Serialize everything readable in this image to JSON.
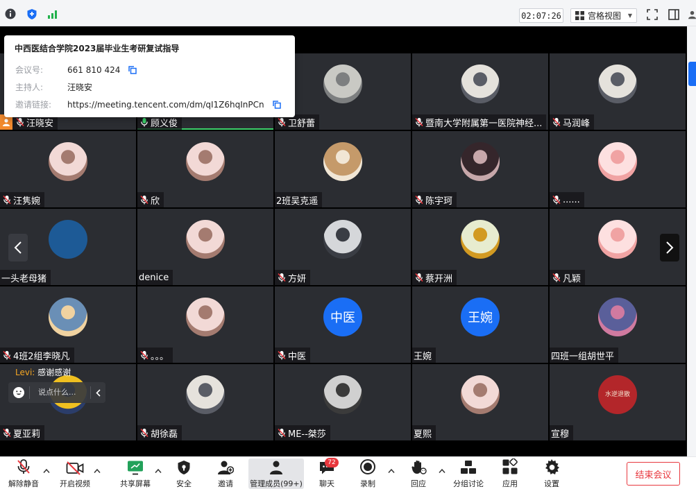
{
  "meeting_info": {
    "title": "中西医结合学院2023届毕业生考研复试指导",
    "rows": [
      {
        "key": "会议号:",
        "value": "661 810 424"
      },
      {
        "key": "主持人:",
        "value": "汪晓安"
      },
      {
        "key": "邀请链接:",
        "value": "https://meeting.tencent.com/dm/qI1Z6hqInPCn"
      }
    ]
  },
  "topbar": {
    "timer": "02:07:26",
    "view_label": "宫格视图"
  },
  "participants": [
    {
      "name": "汪晓安",
      "muted": true,
      "avatar": "none"
    },
    {
      "name": "顾义俊",
      "muted": false,
      "avatar": "none"
    },
    {
      "name": "卫舒蕾",
      "muted": true,
      "avatar": "cat-photo"
    },
    {
      "name": "暨南大学附属第一医院神经...",
      "muted": true,
      "avatar": "man-photo"
    },
    {
      "name": "马润峰",
      "muted": true,
      "avatar": "man-photo"
    },
    {
      "name": "汪隽婉",
      "muted": true,
      "avatar": "girl-photo"
    },
    {
      "name": "欣",
      "muted": true,
      "avatar": "girl-photo"
    },
    {
      "name": "2班吴克遥",
      "muted": false,
      "avatar": "dog-photo"
    },
    {
      "name": "陈宇珂",
      "muted": true,
      "avatar": "art-photo"
    },
    {
      "name": "......",
      "muted": true,
      "avatar": "cartoon-photo"
    },
    {
      "name": "一头老母猪",
      "muted": false,
      "avatar": "blue-circle"
    },
    {
      "name": "denice",
      "muted": false,
      "avatar": "girl-photo"
    },
    {
      "name": "方妍",
      "muted": true,
      "avatar": "face-photo"
    },
    {
      "name": "蔡开洲",
      "muted": true,
      "avatar": "flower-photo"
    },
    {
      "name": "凡颖",
      "muted": true,
      "avatar": "cartoon-photo"
    },
    {
      "name": "4班2组李晓凡",
      "muted": true,
      "avatar": "anime-photo"
    },
    {
      "name": "。。。",
      "muted": true,
      "avatar": "girl-photo"
    },
    {
      "name": "中医",
      "muted": true,
      "avatar": "text",
      "avatar_text": "中医"
    },
    {
      "name": "王婉",
      "muted": false,
      "avatar": "text",
      "avatar_text": "王婉"
    },
    {
      "name": "四班一组胡世平",
      "muted": false,
      "avatar": "sunset-photo"
    },
    {
      "name": "夏亚莉",
      "muted": true,
      "avatar": "painting-photo"
    },
    {
      "name": "胡徐磊",
      "muted": true,
      "avatar": "man-photo"
    },
    {
      "name": "ME--桀莎",
      "muted": true,
      "avatar": "bw-photo"
    },
    {
      "name": "夏熙",
      "muted": false,
      "avatar": "girl-photo"
    },
    {
      "name": "宣穆",
      "muted": false,
      "avatar": "seal",
      "avatar_text": "水逆退散"
    }
  ],
  "chat": {
    "sender": "Levi:",
    "message": "感谢感谢",
    "placeholder": "说点什么..."
  },
  "toolbar": {
    "items": [
      {
        "id": "unmute",
        "label": "解除静音"
      },
      {
        "id": "video",
        "label": "开启视频"
      },
      {
        "id": "share",
        "label": "共享屏幕"
      },
      {
        "id": "security",
        "label": "安全"
      },
      {
        "id": "invite",
        "label": "邀请"
      },
      {
        "id": "members",
        "label": "管理成员(99+)"
      },
      {
        "id": "chat",
        "label": "聊天"
      },
      {
        "id": "record",
        "label": "录制"
      },
      {
        "id": "react",
        "label": "回应"
      },
      {
        "id": "breakout",
        "label": "分组讨论"
      },
      {
        "id": "apps",
        "label": "应用"
      },
      {
        "id": "settings",
        "label": "设置"
      }
    ],
    "chat_badge": "72",
    "end_label": "结束会议"
  },
  "colors": {
    "accent_blue": "#1a6ef5",
    "end_red": "#e8373d",
    "tile_bg": "#2b2d32"
  }
}
